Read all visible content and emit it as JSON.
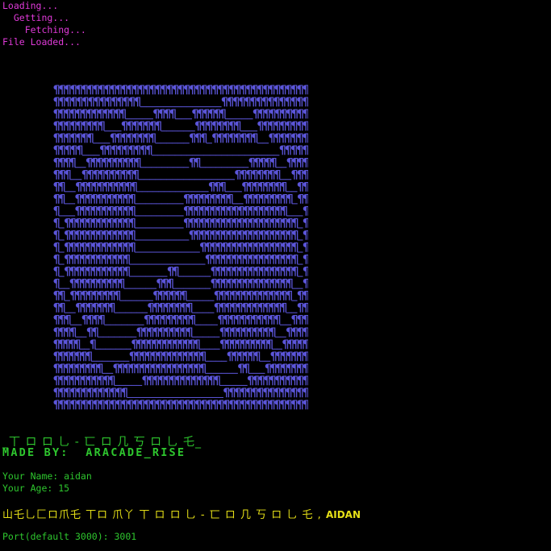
{
  "terminal": {
    "loading_lines": [
      "Loading...",
      "  Getting...",
      "    Fetching...",
      "File Loaded..."
    ],
    "art": {
      "glyph": "¶",
      "fill_color": "#5b55d8",
      "background_color": "#000000",
      "rows": [
        "¶¶¶¶¶¶¶¶¶¶¶¶¶¶¶¶¶¶¶¶¶¶¶¶¶¶¶¶¶¶¶¶¶¶¶¶¶¶¶¶¶¶¶¶¶",
        "¶¶¶¶¶¶¶¶¶¶¶¶¶¶¶______________¶¶¶¶¶¶¶¶¶¶¶¶¶¶¶",
        "¶¶¶¶¶¶¶¶¶¶¶¶¶_____¶¶¶¶___¶¶¶¶¶¶_____¶¶¶¶¶¶¶¶¶¶",
        "¶¶¶¶¶¶¶¶¶___¶¶¶¶¶¶¶______¶¶¶¶¶¶¶¶___¶¶¶¶¶¶¶¶¶",
        "¶¶¶¶¶¶¶___¶¶¶¶¶¶¶¶______¶¶¶_¶¶¶¶¶¶¶¶__¶¶¶¶¶¶¶",
        "¶¶¶¶¶___¶¶¶¶¶¶¶¶¶______________________¶¶¶¶¶",
        "¶¶¶¶__¶¶¶¶¶¶¶¶¶¶_________¶¶_________¶¶¶¶¶__¶¶¶¶",
        "¶¶¶__¶¶¶¶¶¶¶¶¶¶_________________¶¶¶¶¶¶¶¶__¶¶¶",
        "¶¶__¶¶¶¶¶¶¶¶¶¶¶_____________¶¶¶___¶¶¶¶¶¶¶¶__¶¶",
        "¶¶__¶¶¶¶¶¶¶¶¶¶¶_________¶¶¶¶¶¶¶¶¶__¶¶¶¶¶¶¶¶¶_¶¶",
        "¶___¶¶¶¶¶¶¶¶¶¶¶_________¶¶¶¶¶¶¶¶¶¶¶¶¶¶¶¶¶¶¶___¶",
        "¶_¶¶¶¶¶¶¶¶¶¶¶¶¶_________¶¶¶¶¶¶¶¶¶¶¶¶¶¶¶¶¶¶¶¶¶_¶",
        "¶_¶¶¶¶¶¶¶¶¶¶¶¶¶__________¶¶¶¶¶¶¶¶¶¶¶¶¶¶¶¶¶¶¶¶_¶",
        "¶_¶¶¶¶¶¶¶¶¶¶¶¶¶____________¶¶¶¶¶¶¶¶¶¶¶¶¶¶¶¶¶¶_¶",
        "¶_¶¶¶¶¶¶¶¶¶¶¶¶______________¶¶¶¶¶¶¶¶¶¶¶¶¶¶¶¶¶_¶",
        "¶_¶¶¶¶¶¶¶¶¶¶¶¶_______¶¶______¶¶¶¶¶¶¶¶¶¶¶¶¶¶¶¶_¶",
        "¶__¶¶¶¶¶¶¶¶¶¶______¶¶¶_______¶¶¶¶¶¶¶¶¶¶¶¶¶¶¶__¶",
        "¶¶_¶¶¶¶¶¶¶¶¶______¶¶¶¶¶¶_____¶¶¶¶¶¶¶¶¶¶¶¶¶¶_¶¶",
        "¶¶__¶¶¶¶¶¶¶______¶¶¶¶¶¶¶¶____¶¶¶¶¶¶¶¶¶¶¶¶¶__¶¶",
        "¶¶¶__¶¶¶¶_______¶¶¶¶¶¶¶¶¶____¶¶¶¶¶¶¶¶¶¶¶__¶¶¶",
        "¶¶¶¶__¶¶_______¶¶¶¶¶¶¶¶¶¶_____¶¶¶¶¶¶¶¶¶¶__¶¶¶¶",
        "¶¶¶¶¶__¶_______¶¶¶¶¶¶¶¶¶¶¶¶¶____¶¶¶¶¶¶¶¶¶¶__¶¶¶¶¶",
        "¶¶¶¶¶¶¶_______¶¶¶¶¶¶¶¶¶¶¶¶¶¶____¶¶¶¶¶¶__¶¶¶¶¶¶¶",
        "¶¶¶¶¶¶¶¶¶__¶¶¶¶¶¶¶¶¶¶¶¶¶¶¶¶¶______¶¶___¶¶¶¶¶¶¶¶",
        "¶¶¶¶¶¶¶¶¶¶¶_____¶¶¶¶¶¶¶¶¶¶¶¶¶¶_____¶¶¶¶¶¶¶¶¶¶¶",
        "¶¶¶¶¶¶¶¶¶¶¶¶¶_________________¶¶¶¶¶¶¶¶¶¶¶¶¶¶¶",
        "¶¶¶¶¶¶¶¶¶¶¶¶¶¶¶¶¶¶¶¶¶¶¶¶¶¶¶¶¶¶¶¶¶¶¶¶¶¶¶¶¶¶¶¶¶"
      ]
    },
    "banner": "_丅 ロ ロ 乚 - 匸 ロ 几 丂 ロ 乚 乇_",
    "made_by": "MADE BY:  ARACADE_RISE",
    "name_line": "Your Name: aidan",
    "age_line": "Your Age: 15",
    "welcome_text": "山乇乚匚ロ爪乇 丅ロ 爪丫 丅 ロ ロ 乚 - 匸 ロ 几 丂 ロ 乚 乇 ,",
    "welcome_name": "AIDAN",
    "port_line": "Port(default 3000): 3001",
    "colors": {
      "magenta": "#e03ad9",
      "green": "#2ec62e",
      "yellow": "#e6e017"
    }
  }
}
